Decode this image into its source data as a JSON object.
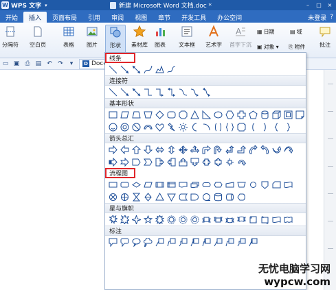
{
  "titlebar": {
    "app_name": "WPS 文字",
    "doc_title": "新建 Microsoft Word 文档.doc *",
    "buttons": [
      "–",
      "□",
      "×"
    ]
  },
  "menu": {
    "tabs": [
      "开始",
      "插入",
      "页面布局",
      "引用",
      "审阅",
      "视图",
      "章节",
      "开发工具",
      "办公空间"
    ],
    "active_tab": "插入",
    "login": "未登录"
  },
  "ribbon": {
    "page_break": "分隔符",
    "blank_page": "空白页",
    "table": "表格",
    "picture": "图片",
    "shapes": "形状",
    "gallery": "素材库",
    "chart": "图表",
    "textbox": "文本框",
    "art_text": "艺术字",
    "first_drop": "首字下沉",
    "date": "日期",
    "field": "域",
    "object": "对象",
    "attachment": "附件",
    "comment": "批注"
  },
  "quickbar": {
    "doc_tab": "Docer"
  },
  "panel": {
    "sections": [
      {
        "title": "线条",
        "highlight": true
      },
      {
        "title": "连接符",
        "highlight": false
      },
      {
        "title": "基本形状",
        "highlight": false
      },
      {
        "title": "箭头总汇",
        "highlight": false
      },
      {
        "title": "流程图",
        "highlight": true
      },
      {
        "title": "星与旗帜",
        "highlight": false
      },
      {
        "title": "标注",
        "highlight": false
      }
    ]
  },
  "watermark": {
    "line1": "无忧电脑学习网",
    "line2": "wypcw.com"
  },
  "colors": {
    "title_bg": "#1f5aa8",
    "menu_bg": "#2f6cc0",
    "highlight_box": "#e0262b",
    "shape_stroke": "#1f4f99"
  }
}
